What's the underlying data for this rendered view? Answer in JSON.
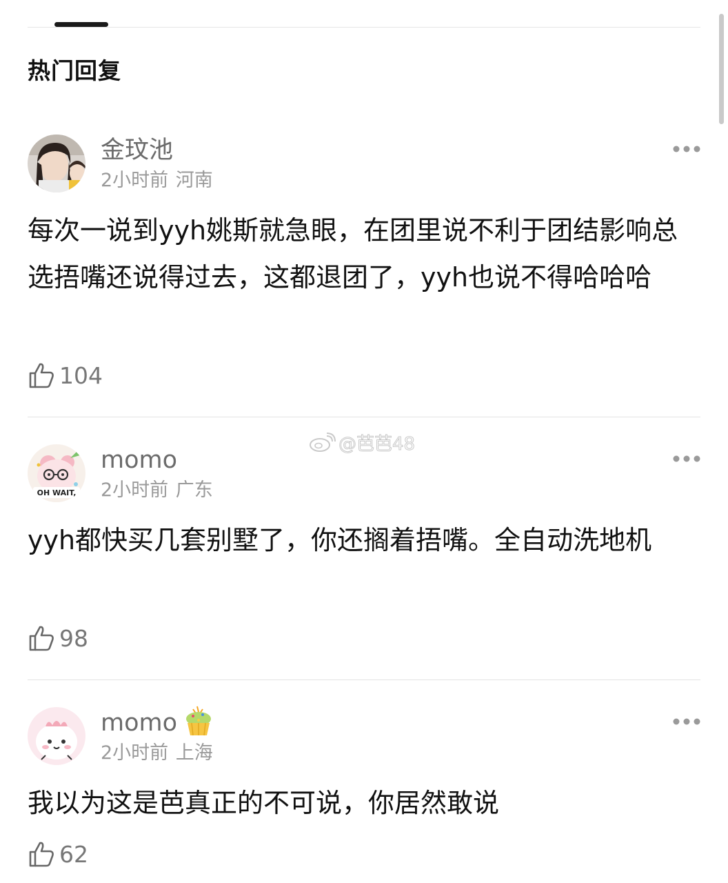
{
  "section": {
    "title": "热门回复"
  },
  "watermark": {
    "text": "@芭芭48"
  },
  "comments": [
    {
      "username": "金玟池",
      "time": "2小时前",
      "location": "河南",
      "text": "每次一说到yyh姚斯就急眼，在团里说不利于团结影响总选捂嘴还说得过去，这都退团了，yyh也说不得哈哈哈",
      "likes": "104"
    },
    {
      "username": "momo",
      "time": "2小时前",
      "location": "广东",
      "avatar_text": "OH WAIT,",
      "text": "yyh都快买几套别墅了，你还搁着捂嘴。全自动洗地机",
      "likes": "98"
    },
    {
      "username": "momo",
      "time": "2小时前",
      "location": "上海",
      "text": "我以为这是芭真正的不可说，你居然敢说",
      "likes": "62"
    }
  ],
  "icons": {
    "more": "more-dots-icon",
    "like": "thumbs-up-icon",
    "badge": "cupcake-icon"
  }
}
